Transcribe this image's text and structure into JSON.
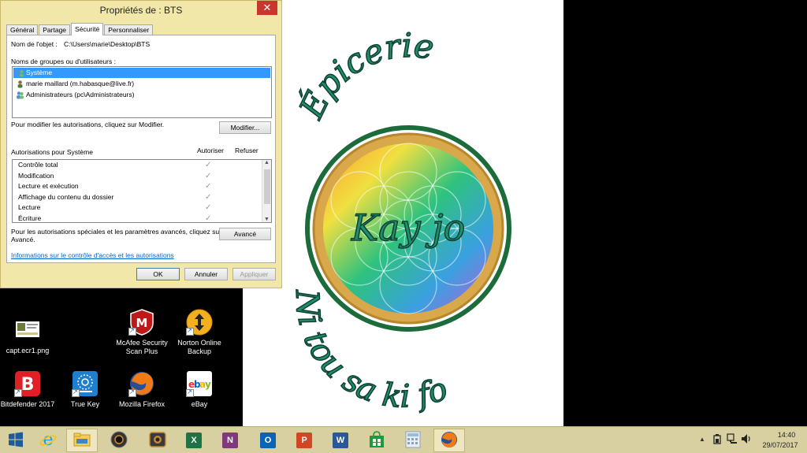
{
  "dialog": {
    "title": "Propriétés de : BTS",
    "close_icon": "close-icon",
    "tabs": [
      {
        "label": "Général"
      },
      {
        "label": "Partage"
      },
      {
        "label": "Sécurité"
      },
      {
        "label": "Personnaliser"
      }
    ],
    "active_tab": "Sécurité",
    "object_name_label": "Nom de l'objet :",
    "object_name_value": "C:\\Users\\marie\\Desktop\\BTS",
    "groups_label": "Noms de groupes ou d'utilisateurs :",
    "users": [
      {
        "name": "Système",
        "icon": "users-group-icon",
        "selected": true
      },
      {
        "name": "marie maillard (m.habasque@live.fr)",
        "icon": "user-icon",
        "selected": false
      },
      {
        "name": "Administrateurs (pc\\Administrateurs)",
        "icon": "users-group-icon",
        "selected": false
      }
    ],
    "modify_hint": "Pour modifier les autorisations, cliquez sur Modifier.",
    "modify_button": "Modifier...",
    "perms_title": "Autorisations pour Système",
    "allow_header": "Autoriser",
    "deny_header": "Refuser",
    "permissions": [
      {
        "label": "Contrôle total",
        "allow": true
      },
      {
        "label": "Modification",
        "allow": true
      },
      {
        "label": "Lecture et exécution",
        "allow": true
      },
      {
        "label": "Affichage du contenu du dossier",
        "allow": true
      },
      {
        "label": "Lecture",
        "allow": true
      },
      {
        "label": "Écriture",
        "allow": true
      }
    ],
    "advanced_hint_1": "Pour les autorisations spéciales et les paramètres avancés, cliquez sur",
    "advanced_hint_2": "Avancé.",
    "advanced_button": "Avancé",
    "info_link": "Informations sur le contrôle d'accès et les autorisations",
    "ok_button": "OK",
    "cancel_button": "Annuler",
    "apply_button": "Appliquer"
  },
  "desktop_icons": [
    {
      "label": "capt.ecr1.png",
      "icon": "image-file-icon"
    },
    {
      "label": "McAfee Security Scan Plus",
      "icon": "mcafee-icon"
    },
    {
      "label": "Norton Online Backup",
      "icon": "norton-backup-icon"
    },
    {
      "label": "Bitdefender 2017",
      "icon": "bitdefender-icon"
    },
    {
      "label": "True Key",
      "icon": "true-key-icon"
    },
    {
      "label": "Mozilla Firefox",
      "icon": "firefox-icon"
    },
    {
      "label": "eBay",
      "icon": "ebay-icon"
    }
  ],
  "wallpaper": {
    "title_top": "Épicerie",
    "center_text": "Kay jo",
    "title_bottom": "Ni tou sa ki fo"
  },
  "taskbar": {
    "items": [
      {
        "icon": "windows-start-icon"
      },
      {
        "icon": "internet-explorer-icon"
      },
      {
        "icon": "file-explorer-icon",
        "active": true
      },
      {
        "icon": "media-player-icon"
      },
      {
        "icon": "camera-app-icon"
      },
      {
        "icon": "excel-icon",
        "glyph": "X"
      },
      {
        "icon": "onenote-icon",
        "glyph": "N"
      },
      {
        "icon": "outlook-icon",
        "glyph": "O"
      },
      {
        "icon": "powerpoint-icon",
        "glyph": "P"
      },
      {
        "icon": "word-icon",
        "glyph": "W"
      },
      {
        "icon": "store-icon"
      },
      {
        "icon": "calculator-icon"
      },
      {
        "icon": "firefox-icon",
        "active": true
      }
    ],
    "tray_icons": [
      "show-hidden-icons",
      "power-icon",
      "network-icon",
      "volume-icon"
    ],
    "clock_time": "14:40",
    "clock_date": "29/07/2017"
  }
}
